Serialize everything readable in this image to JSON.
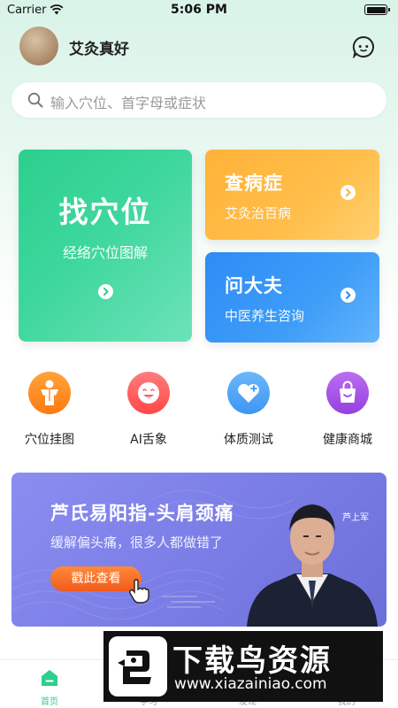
{
  "status_bar": {
    "carrier": "Carrier",
    "time": "5:06 PM"
  },
  "header": {
    "user_name": "艾灸真好",
    "chat_icon": "chat-bubble-icon"
  },
  "search": {
    "placeholder": "输入穴位、首字母或症状"
  },
  "cards": {
    "find_acupoint": {
      "title": "找穴位",
      "subtitle": "经络穴位图解",
      "color": "#2ccf8e"
    },
    "check_symptom": {
      "title": "查病症",
      "subtitle": "艾灸治百病",
      "color": "#ffb238"
    },
    "ask_doctor": {
      "title": "问大夫",
      "subtitle": "中医养生咨询",
      "color": "#2e8cf6"
    }
  },
  "tools": [
    {
      "label": "穴位挂图",
      "icon": "acupoint-chart-icon",
      "color": "#ff8a1f"
    },
    {
      "label": "AI舌象",
      "icon": "tongue-face-icon",
      "color": "#ff5a5a"
    },
    {
      "label": "体质测试",
      "icon": "heart-test-icon",
      "color": "#4aa3f5"
    },
    {
      "label": "健康商城",
      "icon": "shopping-bag-icon",
      "color": "#a14fe6"
    }
  ],
  "banner": {
    "title": "芦氏易阳指-头肩颈痛",
    "subtitle": "缓解偏头痛，很多人都做错了",
    "button": "戳此查看",
    "presenter_name": "芦上军"
  },
  "tab_bar": {
    "tabs": [
      {
        "label": "首页",
        "active": true,
        "icon": "home-icon"
      },
      {
        "label": "学习",
        "active": false,
        "icon": "book-icon"
      },
      {
        "label": "发现",
        "active": false,
        "icon": "discover-icon"
      },
      {
        "label": "我的",
        "active": false,
        "icon": "user-icon"
      }
    ]
  },
  "watermark": {
    "title": "下载鸟资源",
    "url": "www.xiazainiao.com"
  }
}
